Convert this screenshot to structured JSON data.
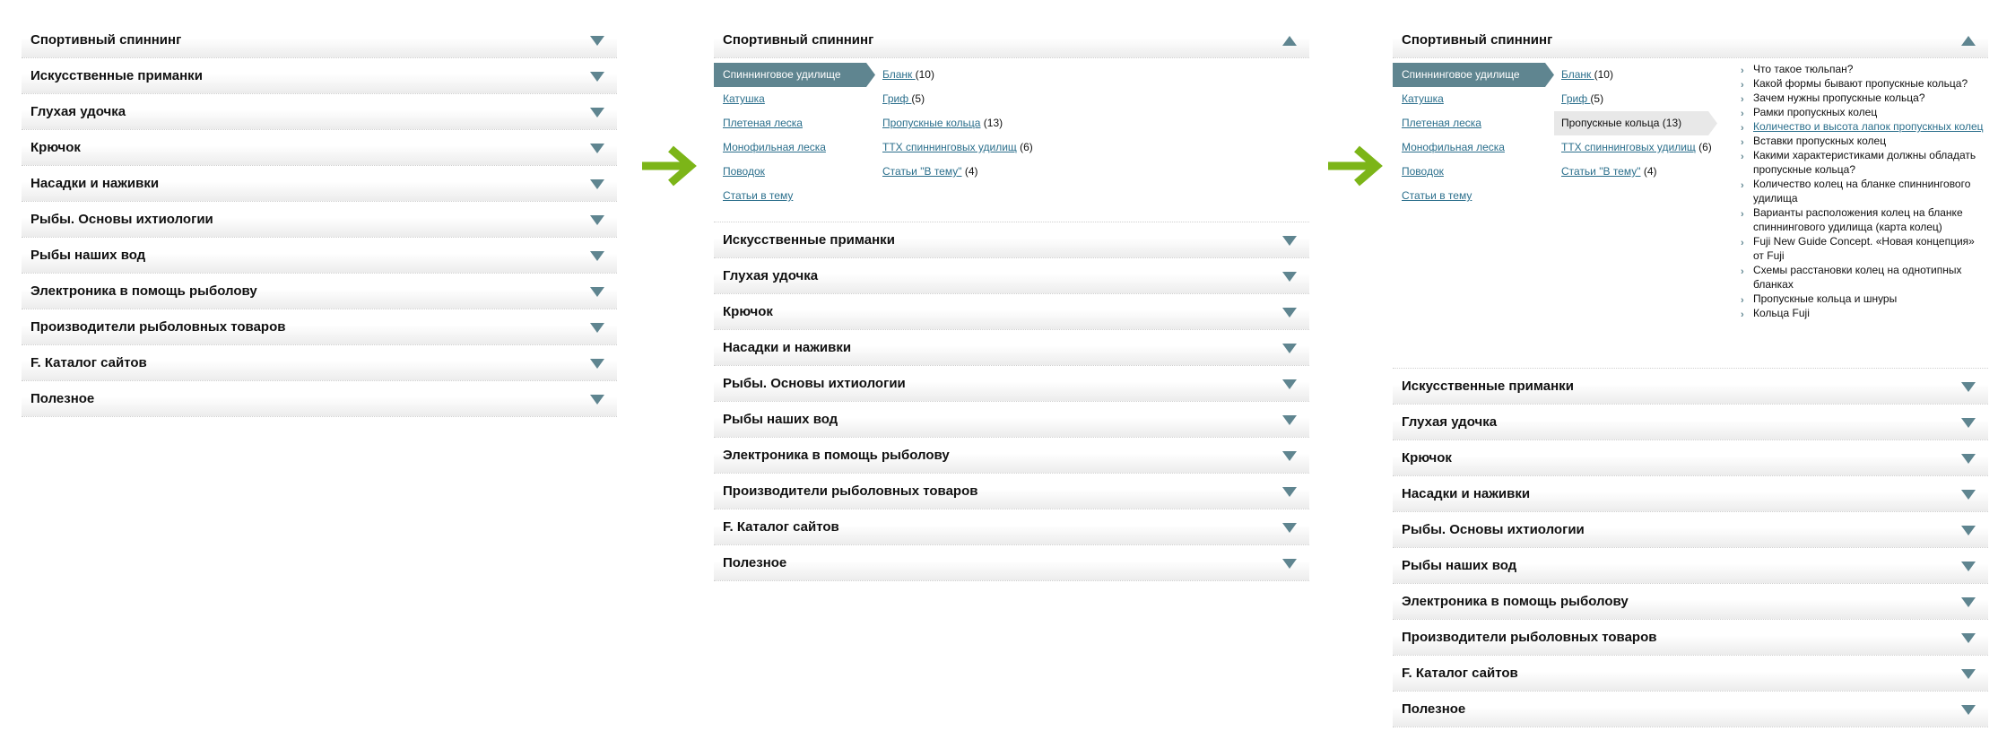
{
  "categories": [
    "Спортивный спиннинг",
    "Искусственные приманки",
    "Глухая удочка",
    "Крючок",
    "Насадки и наживки",
    "Рыбы. Основы ихтиологии",
    "Рыбы наших вод",
    "Электроника в помощь рыболову",
    "Производители рыболовных товаров",
    "F. Каталог сайтов",
    "Полезное"
  ],
  "sub1": [
    "Спиннинговое удилище",
    "Катушка",
    "Плетеная леска",
    "Монофильная леска",
    "Поводок",
    "Статьи в тему"
  ],
  "sub2": [
    {
      "label": "Бланк ",
      "count": "(10)"
    },
    {
      "label": "Гриф ",
      "count": "(5)"
    },
    {
      "label": "Пропускные кольца",
      "count": "(13)"
    },
    {
      "label": "ТТХ спиннинговых удилищ",
      "count": "(6)"
    },
    {
      "label": "Статьи \"В тему\"",
      "count": "(4)"
    }
  ],
  "sub2_active_text": "Пропускные кольца (13)",
  "sub3": [
    {
      "text": "Что такое тюльпан?",
      "link": false
    },
    {
      "text": "Какой формы бывают пропускные кольца?",
      "link": false
    },
    {
      "text": "Зачем нужны пропускные кольца?",
      "link": false
    },
    {
      "text": "Рамки пропускных колец",
      "link": false
    },
    {
      "text": "Количество и высота лапок пропускных колец",
      "link": true
    },
    {
      "text": "Вставки пропускных колец",
      "link": false
    },
    {
      "text": "Какими характеристиками должны обладать пропускные кольца?",
      "link": false
    },
    {
      "text": "Количество колец на бланке спиннингового удилища",
      "link": false
    },
    {
      "text": "Варианты расположения колец на бланке спиннингового удилища (карта колец)",
      "link": false
    },
    {
      "text": "Fuji New Guide Concept. «Новая концепция» от Fuji",
      "link": false
    },
    {
      "text": "Схемы расстановки колец на однотипных бланках",
      "link": false
    },
    {
      "text": "Пропускные кольца и шнуры",
      "link": false
    },
    {
      "text": "Кольца Fuji",
      "link": false
    }
  ],
  "colors": {
    "accent": "#5f8590",
    "link": "#2b6f8c",
    "arrow": "#7cb518"
  },
  "icons": {
    "collapsed": "triangle-down-icon",
    "expanded": "triangle-up-icon",
    "step": "arrow-right-icon",
    "bullet": "chevron-right-icon"
  }
}
